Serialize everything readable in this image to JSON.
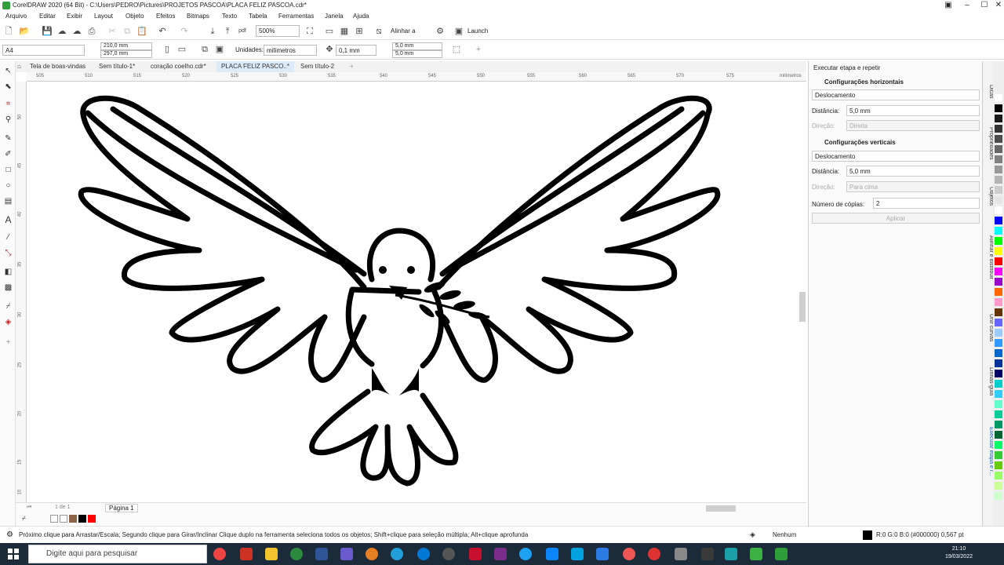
{
  "window": {
    "title": "CorelDRAW 2020 (64 Bit) - C:\\Users\\PEDRO\\Pictures\\PROJETOS PASCOA\\PLACA FELIZ PASCOA.cdr*",
    "minimize": "–",
    "maximize": "☐",
    "close": "✕"
  },
  "menu": [
    "Arquivo",
    "Editar",
    "Exibir",
    "Layout",
    "Objeto",
    "Efeitos",
    "Bitmaps",
    "Texto",
    "Tabela",
    "Ferramentas",
    "Janela",
    "Ajuda"
  ],
  "toolbar": {
    "zoom": "500%",
    "align_label": "Alinhar a",
    "launch_label": "Launch"
  },
  "propbar": {
    "page_size": "A4",
    "width": "210,0 mm",
    "height": "297,0 mm",
    "units_label": "Unidades:",
    "units_value": "milímetros",
    "nudge": "0,1 mm",
    "dup_x": "5,0 mm",
    "dup_y": "5,0 mm"
  },
  "tabs": [
    "Tela de boas-vindas",
    "Sem título-1*",
    "coração coelho.cdr*",
    "PLACA FELIZ PASCO..*",
    "Sem título-2"
  ],
  "ruler": {
    "h_ticks": [
      "505",
      "510",
      "515",
      "520",
      "525",
      "530",
      "535",
      "540",
      "545",
      "550",
      "555",
      "560",
      "565",
      "570",
      "575"
    ],
    "unit": "milímetros",
    "v_ticks": [
      "50",
      "45",
      "40",
      "35",
      "30",
      "25",
      "20",
      "15",
      "10"
    ]
  },
  "page_nav": {
    "page_info": "1 de 1",
    "page_tab": "Página 1"
  },
  "docker": {
    "title": "Executar etapa e repetir",
    "horiz_section": "Configurações horizontais",
    "horiz_mode": "Deslocamento",
    "distance_label": "Distância:",
    "horiz_distance": "5,0 mm",
    "direction_label": "Direção:",
    "horiz_direction": "Direita",
    "vert_section": "Configurações verticais",
    "vert_mode": "Deslocamento",
    "vert_distance": "5,0 mm",
    "vert_direction": "Para cima",
    "copies_label": "Número de cópias:",
    "copies": "2",
    "apply": "Aplicar"
  },
  "side_tabs": [
    "Dicas",
    "Propriedades",
    "Objetos",
    "Alinhar e distribuir",
    "Unir curvas",
    "Linhas-guia",
    "Executar etapa e r..."
  ],
  "status": {
    "hint": "Próximo clique para Arrastar/Escala; Segundo clique para Girar/Inclinar Clique duplo na ferramenta seleciona todos os objetos; Shift+clique para seleção múltipla; Alt+clique aprofunda",
    "fill": "Nenhum",
    "outline": "R:0 G:0 B:0 (#000000)  0,567 pt"
  },
  "taskbar": {
    "search_placeholder": "Digite aqui para pesquisar",
    "time": "21:10",
    "date": "19/03/2022"
  },
  "colors": {
    "palette": [
      "#ffffff",
      "#000000",
      "#1a1a1a",
      "#333333",
      "#4d4d4d",
      "#666666",
      "#808080",
      "#999999",
      "#b3b3b3",
      "#cccccc",
      "#e6e6e6",
      "#ffffff",
      "#0000ff",
      "#00ffff",
      "#00ff00",
      "#ffff00",
      "#ff0000",
      "#ff00ff",
      "#9900cc",
      "#ff6600",
      "#ff99cc",
      "#663300",
      "#6666ff",
      "#99ccff",
      "#3399ff",
      "#0066cc",
      "#003399",
      "#000066",
      "#00cccc",
      "#33ccff",
      "#66ffcc",
      "#00cc99",
      "#009966",
      "#006633",
      "#00ff66",
      "#33cc33",
      "#66cc00",
      "#99ff66",
      "#ccff99",
      "#ccffcc"
    ]
  }
}
